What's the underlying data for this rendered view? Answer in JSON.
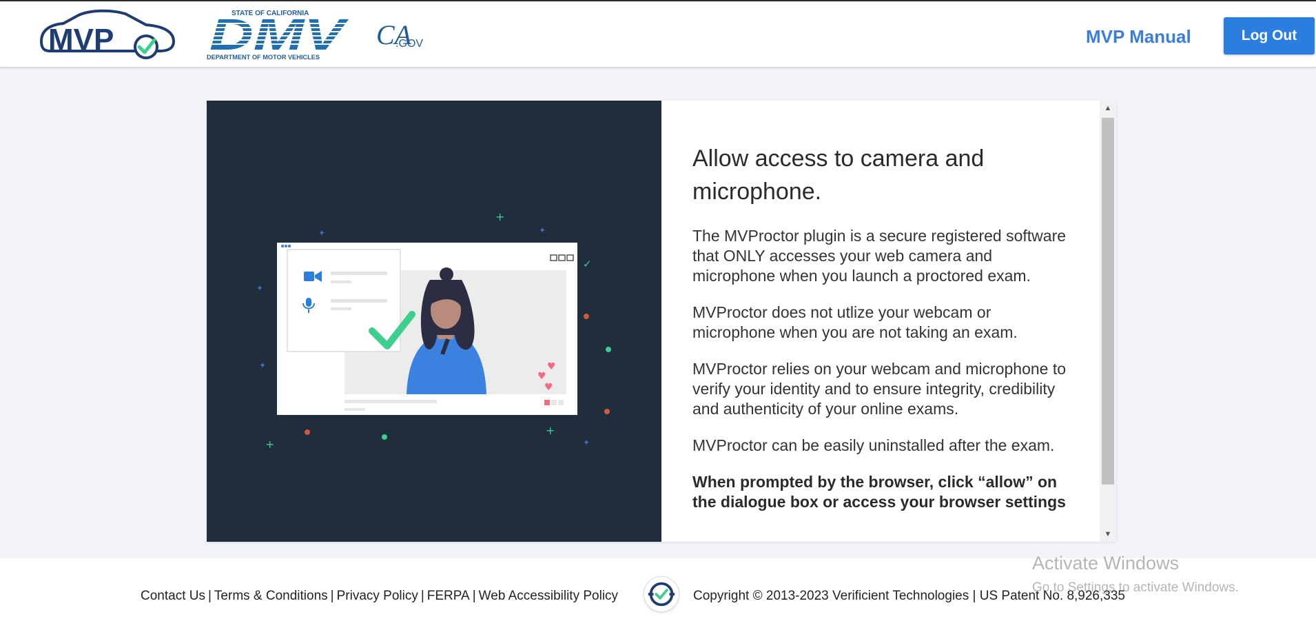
{
  "header": {
    "mvp_logo_text": "MVP",
    "dmv_logo": {
      "top_text": "STATE OF CALIFORNIA",
      "main_text": "DMV",
      "bottom_text": "DEPARTMENT OF MOTOR VEHICLES"
    },
    "cagov_logo": {
      "ca_text": "CA",
      "gov_text": ".GOV"
    },
    "manual_link": "MVP Manual",
    "logout_button": "Log Out"
  },
  "main": {
    "title": "Allow access to camera and microphone.",
    "paragraphs": [
      "The MVProctor plugin is a secure registered software that ONLY accesses your web camera and microphone when you launch a proctored exam.",
      "MVProctor does not utlize your webcam or microphone when you are not taking an exam.",
      "MVProctor relies on your webcam and microphone to verify your identity and to ensure integrity, credibility and authenticity of your online exams.",
      "MVProctor can be easily uninstalled after the exam."
    ],
    "bold_paragraph": "When prompted by the browser, click “allow” on the dialogue box or access your browser settings"
  },
  "footer": {
    "links": [
      "Contact Us",
      "Terms & Conditions",
      "Privacy Policy",
      "FERPA",
      "Web Accessibility Policy"
    ],
    "separator": "|",
    "copyright": "Copyright © 2013-2023 Verificient Technologies | US Patent No. 8,926,335"
  },
  "watermark": {
    "line1": "Activate Windows",
    "line2": "Go to Settings to activate Windows."
  },
  "colors": {
    "accent": "#2b7de0",
    "link": "#3b7ddd",
    "illustration_bg": "#1f2d3d",
    "check_green": "#3ecf8e",
    "mvp_navy": "#1f3c73"
  },
  "icons": [
    "camera-icon",
    "microphone-icon",
    "checkmark-icon",
    "heart-icon"
  ]
}
